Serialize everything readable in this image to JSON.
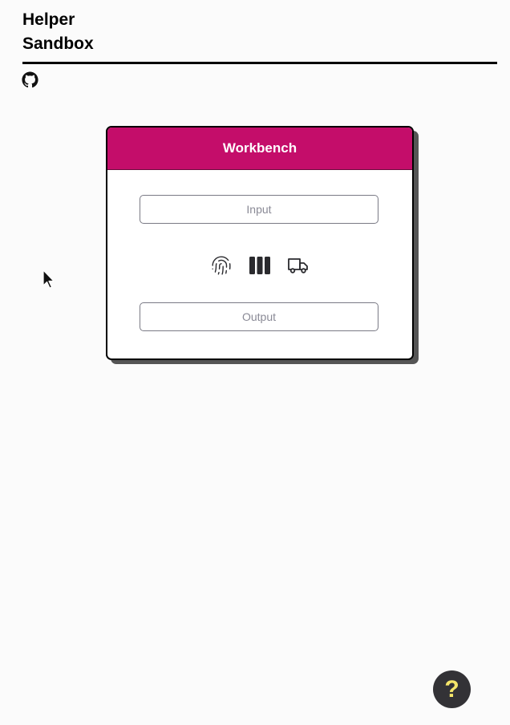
{
  "site": {
    "title_line1": "Helper",
    "title_line2": "Sandbox"
  },
  "header": {
    "github_icon": "github-icon"
  },
  "card": {
    "title": "Workbench",
    "accent_color": "#c40d6a",
    "input": {
      "placeholder": "Input",
      "value": ""
    },
    "output": {
      "placeholder": "Output",
      "value": ""
    },
    "actions": [
      {
        "icon": "fingerprint-icon"
      },
      {
        "icon": "columns-icon"
      },
      {
        "icon": "truck-icon"
      }
    ]
  },
  "help": {
    "label": "?",
    "background": "#333236",
    "color": "#f5e66a"
  }
}
